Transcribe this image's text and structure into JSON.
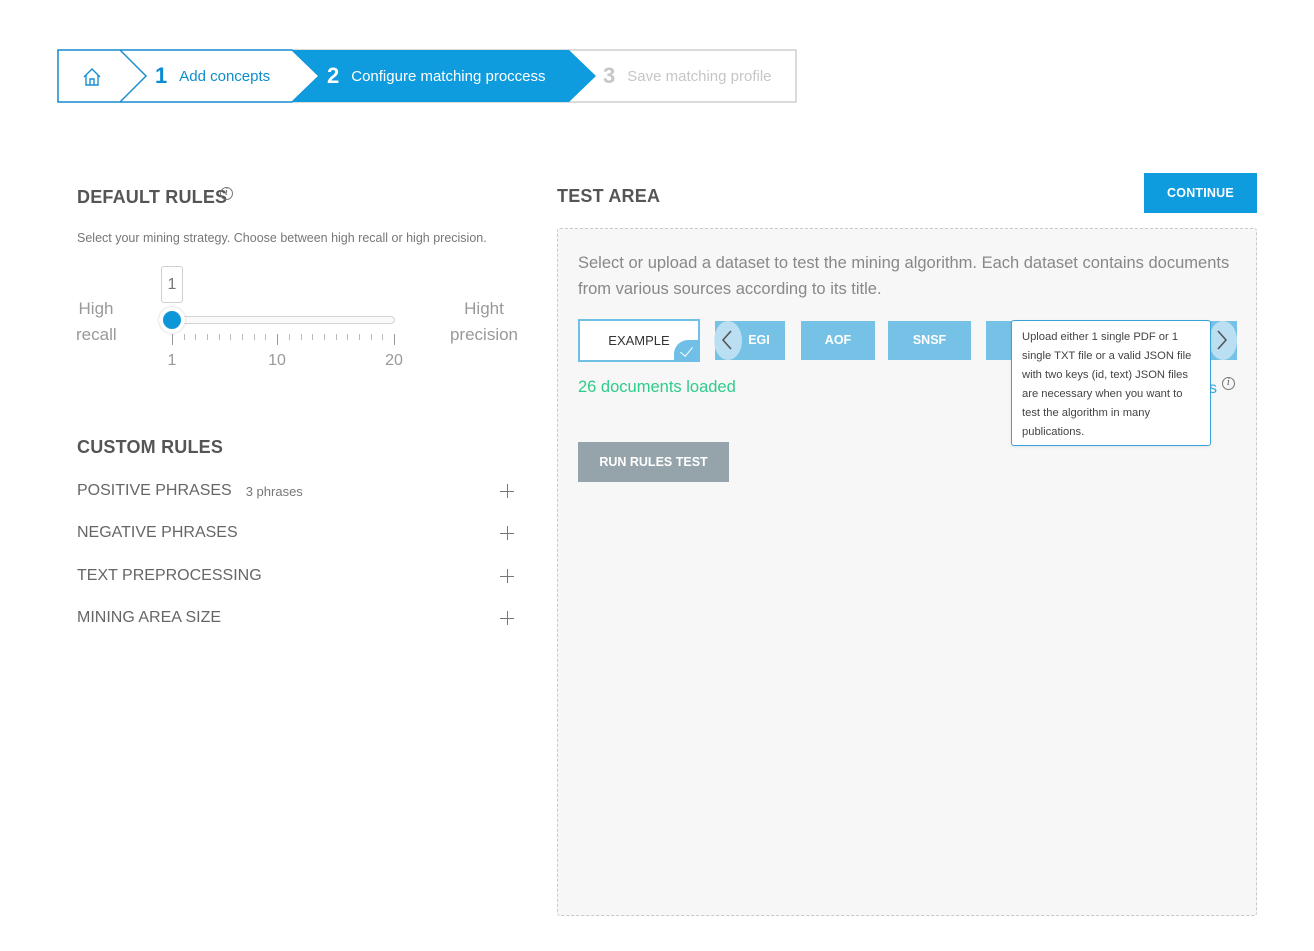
{
  "wizard": {
    "home_icon": "home-icon",
    "steps": [
      {
        "number": "1",
        "label": "Add concepts",
        "state": "done"
      },
      {
        "number": "2",
        "label": "Configure matching proccess",
        "state": "active"
      },
      {
        "number": "3",
        "label": "Save matching profile",
        "state": "disabled"
      }
    ]
  },
  "default_rules": {
    "title": "DEFAULT RULES",
    "description": "Select your mining strategy. Choose between high recall or high precision.",
    "slider": {
      "value": "1",
      "min": 1,
      "max": 20,
      "left_label_1": "High",
      "left_label_2": "recall",
      "right_label_1": "Hight",
      "right_label_2": "precision",
      "tick_labels": [
        "1",
        "10",
        "20"
      ]
    }
  },
  "custom_rules": {
    "title": "CUSTOM RULES",
    "items": [
      {
        "label": "POSITIVE PHRASES",
        "count": "3 phrases"
      },
      {
        "label": "NEGATIVE PHRASES",
        "count": ""
      },
      {
        "label": "TEXT PREPROCESSING",
        "count": ""
      },
      {
        "label": "MINING AREA SIZE",
        "count": ""
      }
    ]
  },
  "test_area": {
    "title": "TEST AREA",
    "continue_label": "CONTINUE",
    "description": "Select or upload a dataset to test the mining algorithm. Each dataset contains documents from various sources according to its title.",
    "datasets": [
      {
        "label": "EXAMPLE",
        "selected": true
      },
      {
        "label": "EGI",
        "selected": false
      },
      {
        "label": "AOF",
        "selected": false
      },
      {
        "label": "SNSF",
        "selected": false
      }
    ],
    "documents_loaded": "26 documents loaded",
    "partial_link_text": "s",
    "run_label": "RUN RULES TEST",
    "tooltip": "Upload either 1 single PDF or 1 single TXT file or a valid JSON file with two keys (id, text) JSON files are necessary when you want to test the algorithm in many publications."
  },
  "colors": {
    "primary": "#0e9cde",
    "dataset_tile": "#76c2e6",
    "success_text": "#2ecc8a",
    "run_button": "#95a4ab"
  }
}
